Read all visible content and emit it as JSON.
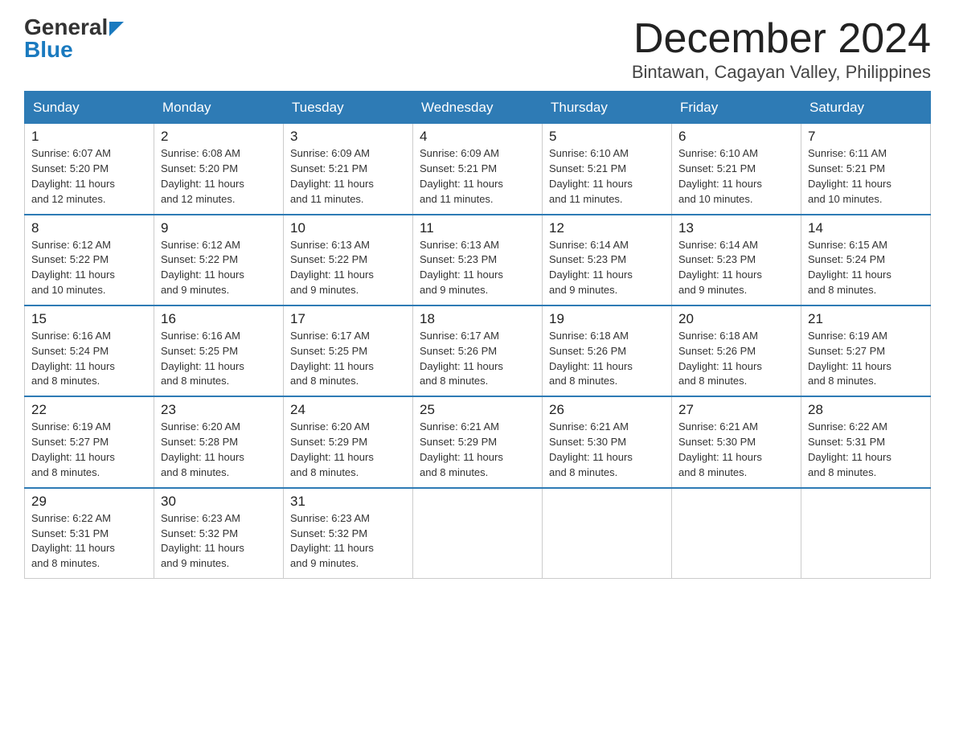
{
  "header": {
    "logo_general": "General",
    "logo_blue": "Blue",
    "month_title": "December 2024",
    "location": "Bintawan, Cagayan Valley, Philippines"
  },
  "days_of_week": [
    "Sunday",
    "Monday",
    "Tuesday",
    "Wednesday",
    "Thursday",
    "Friday",
    "Saturday"
  ],
  "weeks": [
    [
      {
        "day": "1",
        "sunrise": "6:07 AM",
        "sunset": "5:20 PM",
        "daylight": "11 hours and 12 minutes."
      },
      {
        "day": "2",
        "sunrise": "6:08 AM",
        "sunset": "5:20 PM",
        "daylight": "11 hours and 12 minutes."
      },
      {
        "day": "3",
        "sunrise": "6:09 AM",
        "sunset": "5:21 PM",
        "daylight": "11 hours and 11 minutes."
      },
      {
        "day": "4",
        "sunrise": "6:09 AM",
        "sunset": "5:21 PM",
        "daylight": "11 hours and 11 minutes."
      },
      {
        "day": "5",
        "sunrise": "6:10 AM",
        "sunset": "5:21 PM",
        "daylight": "11 hours and 11 minutes."
      },
      {
        "day": "6",
        "sunrise": "6:10 AM",
        "sunset": "5:21 PM",
        "daylight": "11 hours and 10 minutes."
      },
      {
        "day": "7",
        "sunrise": "6:11 AM",
        "sunset": "5:21 PM",
        "daylight": "11 hours and 10 minutes."
      }
    ],
    [
      {
        "day": "8",
        "sunrise": "6:12 AM",
        "sunset": "5:22 PM",
        "daylight": "11 hours and 10 minutes."
      },
      {
        "day": "9",
        "sunrise": "6:12 AM",
        "sunset": "5:22 PM",
        "daylight": "11 hours and 9 minutes."
      },
      {
        "day": "10",
        "sunrise": "6:13 AM",
        "sunset": "5:22 PM",
        "daylight": "11 hours and 9 minutes."
      },
      {
        "day": "11",
        "sunrise": "6:13 AM",
        "sunset": "5:23 PM",
        "daylight": "11 hours and 9 minutes."
      },
      {
        "day": "12",
        "sunrise": "6:14 AM",
        "sunset": "5:23 PM",
        "daylight": "11 hours and 9 minutes."
      },
      {
        "day": "13",
        "sunrise": "6:14 AM",
        "sunset": "5:23 PM",
        "daylight": "11 hours and 9 minutes."
      },
      {
        "day": "14",
        "sunrise": "6:15 AM",
        "sunset": "5:24 PM",
        "daylight": "11 hours and 8 minutes."
      }
    ],
    [
      {
        "day": "15",
        "sunrise": "6:16 AM",
        "sunset": "5:24 PM",
        "daylight": "11 hours and 8 minutes."
      },
      {
        "day": "16",
        "sunrise": "6:16 AM",
        "sunset": "5:25 PM",
        "daylight": "11 hours and 8 minutes."
      },
      {
        "day": "17",
        "sunrise": "6:17 AM",
        "sunset": "5:25 PM",
        "daylight": "11 hours and 8 minutes."
      },
      {
        "day": "18",
        "sunrise": "6:17 AM",
        "sunset": "5:26 PM",
        "daylight": "11 hours and 8 minutes."
      },
      {
        "day": "19",
        "sunrise": "6:18 AM",
        "sunset": "5:26 PM",
        "daylight": "11 hours and 8 minutes."
      },
      {
        "day": "20",
        "sunrise": "6:18 AM",
        "sunset": "5:26 PM",
        "daylight": "11 hours and 8 minutes."
      },
      {
        "day": "21",
        "sunrise": "6:19 AM",
        "sunset": "5:27 PM",
        "daylight": "11 hours and 8 minutes."
      }
    ],
    [
      {
        "day": "22",
        "sunrise": "6:19 AM",
        "sunset": "5:27 PM",
        "daylight": "11 hours and 8 minutes."
      },
      {
        "day": "23",
        "sunrise": "6:20 AM",
        "sunset": "5:28 PM",
        "daylight": "11 hours and 8 minutes."
      },
      {
        "day": "24",
        "sunrise": "6:20 AM",
        "sunset": "5:29 PM",
        "daylight": "11 hours and 8 minutes."
      },
      {
        "day": "25",
        "sunrise": "6:21 AM",
        "sunset": "5:29 PM",
        "daylight": "11 hours and 8 minutes."
      },
      {
        "day": "26",
        "sunrise": "6:21 AM",
        "sunset": "5:30 PM",
        "daylight": "11 hours and 8 minutes."
      },
      {
        "day": "27",
        "sunrise": "6:21 AM",
        "sunset": "5:30 PM",
        "daylight": "11 hours and 8 minutes."
      },
      {
        "day": "28",
        "sunrise": "6:22 AM",
        "sunset": "5:31 PM",
        "daylight": "11 hours and 8 minutes."
      }
    ],
    [
      {
        "day": "29",
        "sunrise": "6:22 AM",
        "sunset": "5:31 PM",
        "daylight": "11 hours and 8 minutes."
      },
      {
        "day": "30",
        "sunrise": "6:23 AM",
        "sunset": "5:32 PM",
        "daylight": "11 hours and 9 minutes."
      },
      {
        "day": "31",
        "sunrise": "6:23 AM",
        "sunset": "5:32 PM",
        "daylight": "11 hours and 9 minutes."
      },
      null,
      null,
      null,
      null
    ]
  ],
  "labels": {
    "sunrise": "Sunrise:",
    "sunset": "Sunset:",
    "daylight": "Daylight:"
  }
}
